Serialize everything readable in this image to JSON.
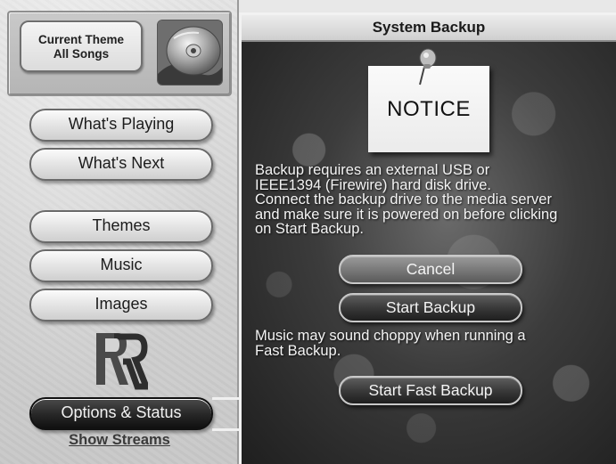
{
  "sidebar": {
    "current_theme": {
      "line1": "Current Theme",
      "line2": "All Songs",
      "art_icon": "cd-disc-icon"
    },
    "nav": [
      {
        "label": "What's Playing"
      },
      {
        "label": "What's Next"
      },
      {
        "label": "Themes"
      },
      {
        "label": "Music"
      },
      {
        "label": "Images"
      },
      {
        "label": "Options & Status",
        "selected": true
      }
    ],
    "logo": "rr-logo-icon",
    "show_streams": "Show Streams"
  },
  "main": {
    "title": "System Backup",
    "notice_label": "NOTICE",
    "pin_icon": "pushpin-icon",
    "paragraph1_lines": [
      "Backup requires an external USB or",
      "IEEE1394 (Firewire) hard disk drive.",
      "Connect the backup drive to the media server",
      "and make sure it is powered on before clicking",
      "on Start Backup."
    ],
    "cancel_label": "Cancel",
    "start_backup_label": "Start Backup",
    "paragraph2_lines": [
      "Music may sound choppy when running a",
      "Fast Backup."
    ],
    "start_fast_backup_label": "Start Fast Backup"
  },
  "colors": {
    "panel_bg": "#3c3c3c",
    "header_bg": "#dcdcdc",
    "selected_tab": "#1c1c1c"
  }
}
